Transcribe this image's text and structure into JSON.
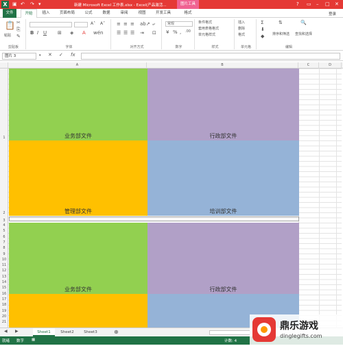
{
  "titlebar": {
    "title": "新建 Microsoft Excel 工作表.xlsx - Excel(产品激活...",
    "picture_tools": "图片工具",
    "help": "?",
    "colors": {
      "bar": "#e53935",
      "picture_tools": "#f06292"
    }
  },
  "ribbon_tabs": {
    "file": "文件",
    "items": [
      "开始",
      "插入",
      "页面布局",
      "公式",
      "数据",
      "审阅",
      "视图",
      "开发工具",
      "格式"
    ],
    "login": "登录"
  },
  "ribbon": {
    "paste": "粘贴",
    "clipboard": "剪贴板",
    "font": "字体",
    "alignment": "对齐方式",
    "number": "数字",
    "number_format": "常规",
    "styles": "样式",
    "conditional_format": "条件格式",
    "table_format": "套用表格格式",
    "cell_styles": "单元格样式",
    "cells": "单元格",
    "insert": "插入",
    "delete": "删除",
    "format": "格式",
    "editing": "编辑",
    "sort_filter": "排序和筛选",
    "find_select": "查找和选择"
  },
  "formula_bar": {
    "name_box": "图片 3",
    "fx": "fx",
    "value": ""
  },
  "columns": [
    "A",
    "B",
    "C",
    "D"
  ],
  "rows": [
    "1",
    "2",
    "3",
    "4",
    "5",
    "6",
    "7",
    "8",
    "9",
    "10",
    "11",
    "12",
    "13",
    "14",
    "15",
    "16",
    "17",
    "18",
    "19",
    "20",
    "21"
  ],
  "blocks": [
    {
      "label": "业务部文件",
      "color": "#92d050"
    },
    {
      "label": "行政部文件",
      "color": "#b1a0c7"
    },
    {
      "label": "管理部文件",
      "color": "#ffc000"
    },
    {
      "label": "培训部文件",
      "color": "#95b3d7"
    },
    {
      "label": "业务部文件",
      "color": "#92d050"
    },
    {
      "label": "行政部文件",
      "color": "#b1a0c7"
    },
    {
      "label": "",
      "color": "#ffc000"
    },
    {
      "label": "",
      "color": "#95b3d7"
    }
  ],
  "sheets": [
    "Sheet1",
    "Sheet2",
    "Sheet3"
  ],
  "status": {
    "ready": "就绪",
    "num": "数字",
    "count": "计数: 4",
    "colors": {
      "bar": "#217346"
    }
  },
  "watermark": {
    "brand": "鼎乐游戏",
    "url": "dinglegifts.com"
  }
}
